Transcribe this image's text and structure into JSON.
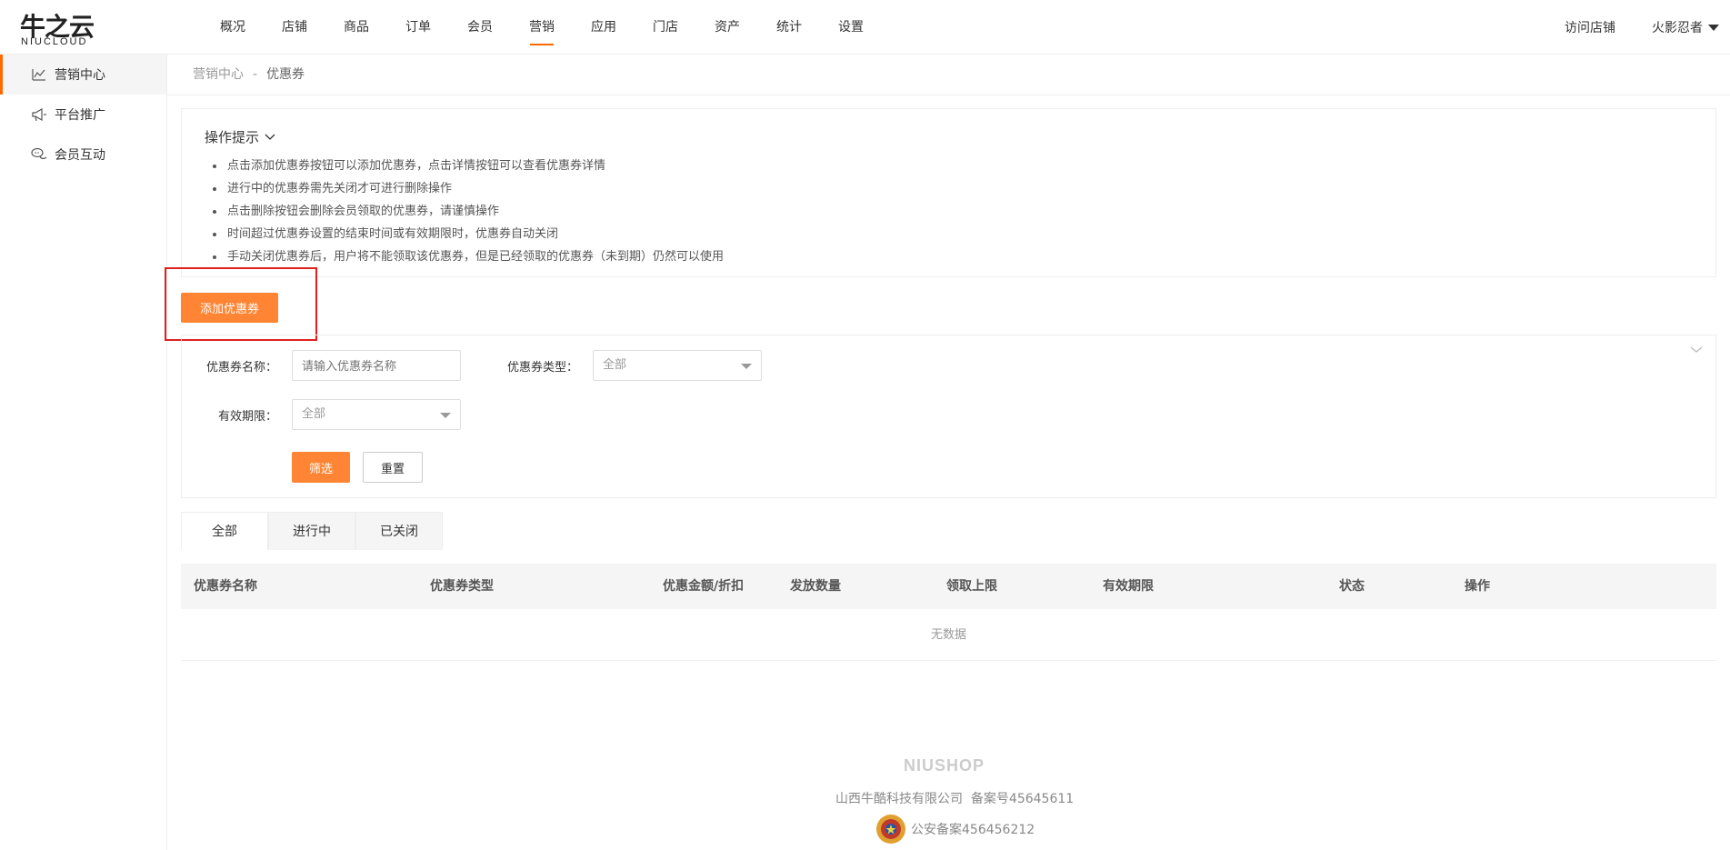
{
  "brand": {
    "cn": "牛之云",
    "en": "NIUCLOUD"
  },
  "nav": [
    "概况",
    "店铺",
    "商品",
    "订单",
    "会员",
    "营销",
    "应用",
    "门店",
    "资产",
    "统计",
    "设置"
  ],
  "nav_active_index": 5,
  "top_right": {
    "visit": "访问店铺",
    "user": "火影忍者"
  },
  "sidebar": [
    {
      "label": "营销中心",
      "icon": "chart-icon",
      "active": true
    },
    {
      "label": "平台推广",
      "icon": "megaphone-icon",
      "active": false
    },
    {
      "label": "会员互动",
      "icon": "chat-icon",
      "active": false
    }
  ],
  "breadcrumb": {
    "parent": "营销中心",
    "sep": "-",
    "current": "优惠券"
  },
  "tips": {
    "title": "操作提示",
    "items": [
      "点击添加优惠券按钮可以添加优惠券，点击详情按钮可以查看优惠券详情",
      "进行中的优惠券需先关闭才可进行删除操作",
      "点击删除按钮会删除会员领取的优惠券，请谨慎操作",
      "时间超过优惠券设置的结束时间或有效期限时，优惠券自动关闭",
      "手动关闭优惠券后，用户将不能领取该优惠券，但是已经领取的优惠券（未到期）仍然可以使用"
    ]
  },
  "add_button": "添加优惠券",
  "filter": {
    "name_label": "优惠券名称：",
    "name_placeholder": "请输入优惠券名称",
    "type_label": "优惠券类型：",
    "type_value": "全部",
    "validity_label": "有效期限：",
    "validity_value": "全部",
    "submit": "筛选",
    "reset": "重置"
  },
  "tabs": [
    "全部",
    "进行中",
    "已关闭"
  ],
  "tab_active_index": 0,
  "table": {
    "columns": [
      "优惠券名称",
      "优惠券类型",
      "优惠金额/折扣",
      "发放数量",
      "领取上限",
      "有效期限",
      "状态",
      "操作"
    ],
    "empty": "无数据"
  },
  "footer": {
    "logo": "NIUSHOP",
    "company": "山西牛酷科技有限公司",
    "icp": "备案号45645611",
    "police": "公安备案456456212"
  },
  "colors": {
    "accent": "#ff8433",
    "highlight": "#e02020"
  }
}
